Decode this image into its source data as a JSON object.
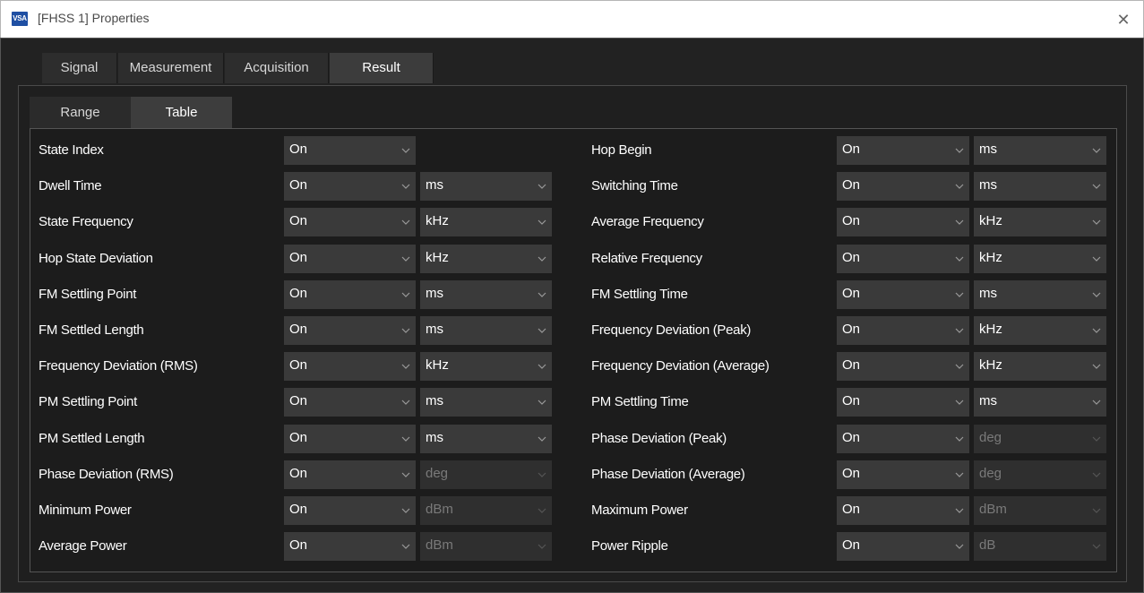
{
  "window": {
    "icon_text": "VSA",
    "title": "[FHSS 1] Properties",
    "close_glyph": "✕"
  },
  "main_tabs": [
    {
      "label": "Signal",
      "active": false
    },
    {
      "label": "Measurement",
      "active": false
    },
    {
      "label": "Acquisition",
      "active": false
    },
    {
      "label": "Result",
      "active": true
    }
  ],
  "sub_tabs": [
    {
      "label": "Range",
      "active": false
    },
    {
      "label": "Table",
      "active": true
    }
  ],
  "left_rows": [
    {
      "label": "State Index",
      "toggle": "On",
      "unit": null,
      "unit_enabled": true
    },
    {
      "label": "Dwell Time",
      "toggle": "On",
      "unit": "ms",
      "unit_enabled": true
    },
    {
      "label": "State Frequency",
      "toggle": "On",
      "unit": "kHz",
      "unit_enabled": true
    },
    {
      "label": "Hop State Deviation",
      "toggle": "On",
      "unit": "kHz",
      "unit_enabled": true
    },
    {
      "label": "FM Settling Point",
      "toggle": "On",
      "unit": "ms",
      "unit_enabled": true
    },
    {
      "label": "FM Settled Length",
      "toggle": "On",
      "unit": "ms",
      "unit_enabled": true
    },
    {
      "label": "Frequency Deviation (RMS)",
      "toggle": "On",
      "unit": "kHz",
      "unit_enabled": true
    },
    {
      "label": "PM Settling Point",
      "toggle": "On",
      "unit": "ms",
      "unit_enabled": true
    },
    {
      "label": "PM Settled Length",
      "toggle": "On",
      "unit": "ms",
      "unit_enabled": true
    },
    {
      "label": "Phase Deviation (RMS)",
      "toggle": "On",
      "unit": "deg",
      "unit_enabled": false
    },
    {
      "label": "Minimum Power",
      "toggle": "On",
      "unit": "dBm",
      "unit_enabled": false
    },
    {
      "label": "Average Power",
      "toggle": "On",
      "unit": "dBm",
      "unit_enabled": false
    }
  ],
  "right_rows": [
    {
      "label": "Hop Begin",
      "toggle": "On",
      "unit": "ms",
      "unit_enabled": true
    },
    {
      "label": "Switching Time",
      "toggle": "On",
      "unit": "ms",
      "unit_enabled": true
    },
    {
      "label": "Average Frequency",
      "toggle": "On",
      "unit": "kHz",
      "unit_enabled": true
    },
    {
      "label": "Relative Frequency",
      "toggle": "On",
      "unit": "kHz",
      "unit_enabled": true
    },
    {
      "label": "FM Settling Time",
      "toggle": "On",
      "unit": "ms",
      "unit_enabled": true
    },
    {
      "label": "Frequency Deviation (Peak)",
      "toggle": "On",
      "unit": "kHz",
      "unit_enabled": true
    },
    {
      "label": "Frequency Deviation (Average)",
      "toggle": "On",
      "unit": "kHz",
      "unit_enabled": true
    },
    {
      "label": "PM Settling Time",
      "toggle": "On",
      "unit": "ms",
      "unit_enabled": true
    },
    {
      "label": "Phase Deviation (Peak)",
      "toggle": "On",
      "unit": "deg",
      "unit_enabled": false
    },
    {
      "label": "Phase Deviation (Average)",
      "toggle": "On",
      "unit": "deg",
      "unit_enabled": false
    },
    {
      "label": "Maximum Power",
      "toggle": "On",
      "unit": "dBm",
      "unit_enabled": false
    },
    {
      "label": "Power Ripple",
      "toggle": "On",
      "unit": "dB",
      "unit_enabled": false
    }
  ],
  "colors": {
    "background": "#222222",
    "dropdown": "#3a3a3a",
    "dropdown_disabled": "#2f2f2f",
    "text": "#ffffff",
    "text_disabled": "#7a7a7a"
  }
}
